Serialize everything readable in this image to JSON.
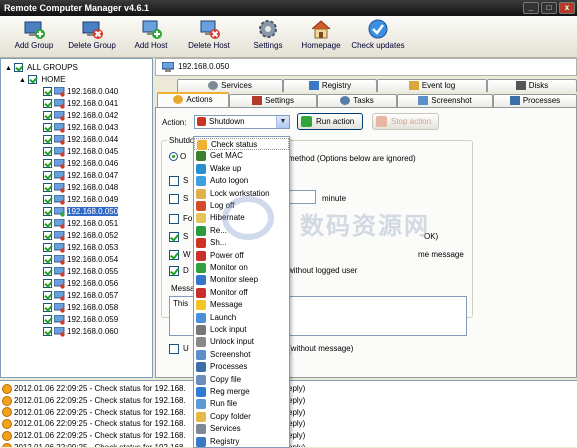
{
  "window": {
    "title": "Remote Computer Manager v4.6.1",
    "minimize": "_",
    "maximize": "□",
    "close": "x"
  },
  "toolbar": [
    {
      "label": "Add Group",
      "icon": "add-group-icon"
    },
    {
      "label": "Delete Group",
      "icon": "delete-group-icon"
    },
    {
      "label": "Add Host",
      "icon": "add-host-icon"
    },
    {
      "label": "Delete Host",
      "icon": "delete-host-icon"
    },
    {
      "label": "Settings",
      "icon": "gear-icon"
    },
    {
      "label": "Homepage",
      "icon": "home-icon"
    },
    {
      "label": "Check updates",
      "icon": "check-updates-icon"
    }
  ],
  "tree": {
    "root": "ALL GROUPS",
    "group": "HOME",
    "hosts": [
      "192.168.0.040",
      "192.168.0.041",
      "192.168.0.042",
      "192.168.0.043",
      "192.168.0.044",
      "192.168.0.045",
      "192.168.0.046",
      "192.168.0.047",
      "192.168.0.048",
      "192.168.0.049",
      "192.168.0.050",
      "192.168.0.051",
      "192.168.0.052",
      "192.168.0.053",
      "192.168.0.054",
      "192.168.0.055",
      "192.168.0.056",
      "192.168.0.057",
      "192.168.0.058",
      "192.168.0.059",
      "192.168.0.060"
    ]
  },
  "host_header": "192.168.0.050",
  "tabs_row1": [
    "Services",
    "Registry",
    "Event log",
    "Disks"
  ],
  "tabs_row2": [
    "Actions",
    "Settings",
    "Tasks",
    "Screenshot",
    "Processes"
  ],
  "actions": {
    "action_label": "Action:",
    "selected_action": "Shutdown",
    "run_button": "Run action",
    "stop_button": "Stop action",
    "shutdown_group": "Shutdo",
    "method_text": "method (Options below are ignored)",
    "minute_label": "minute",
    "ok_fragment": "OK)",
    "message_fragment": "me message",
    "without_user": "without logged user",
    "message_label": "Messa",
    "message_value": "This",
    "without_message": "(without message)",
    "option_labels": [
      "O",
      "S",
      "S",
      "Fo",
      "S",
      "W",
      "D",
      "U"
    ]
  },
  "dropdown_items": [
    {
      "label": "Check status",
      "color": "#f0b130"
    },
    {
      "label": "Get MAC",
      "color": "#3d7f2a"
    },
    {
      "label": "Wake up",
      "color": "#2a8fd1"
    },
    {
      "label": "Auto logon",
      "color": "#3aa0e0"
    },
    {
      "label": "Lock workstation",
      "color": "#e2b04a"
    },
    {
      "label": "Log off",
      "color": "#d24b2a"
    },
    {
      "label": "Hibernate",
      "color": "#e7c35b"
    },
    {
      "label": "Re...",
      "color": "#2b9a3a"
    },
    {
      "label": "Sh...",
      "color": "#cc3322"
    },
    {
      "label": "Power off",
      "color": "#c9302c"
    },
    {
      "label": "Monitor on",
      "color": "#32a041"
    },
    {
      "label": "Monitor sleep",
      "color": "#3377cc"
    },
    {
      "label": "Monitor off",
      "color": "#c9302c"
    },
    {
      "label": "Message",
      "color": "#f3c623"
    },
    {
      "label": "Launch",
      "color": "#4a90d9"
    },
    {
      "label": "Lock input",
      "color": "#777777"
    },
    {
      "label": "Unlock input",
      "color": "#888888"
    },
    {
      "label": "Screenshot",
      "color": "#5a8fc9"
    },
    {
      "label": "Processes",
      "color": "#3c6ea8"
    },
    {
      "label": "Copy file",
      "color": "#6a8fbf"
    },
    {
      "label": "Reg merge",
      "color": "#2f7bd1"
    },
    {
      "label": "Run file",
      "color": "#5b9bd5"
    },
    {
      "label": "Copy folder",
      "color": "#e6b84a"
    },
    {
      "label": "Services",
      "color": "#7d8a96"
    },
    {
      "label": "Registry",
      "color": "#3b78c4"
    }
  ],
  "log": [
    {
      "time": "2012.01.06 22:09:25",
      "text": "- Check status for 192.168.",
      "tail": "eply)"
    },
    {
      "time": "2012.01.06 22:09:25",
      "text": "- Check status for 192.168.",
      "tail": "eply)"
    },
    {
      "time": "2012.01.06 22:09:25",
      "text": "- Check status for 192.168.",
      "tail": "eply)"
    },
    {
      "time": "2012.01.06 22:09:25",
      "text": "- Check status for 192.168.",
      "tail": "eply)"
    },
    {
      "time": "2012.01.06 22:09:25",
      "text": "- Check status for 192.168.",
      "tail": "eply)"
    },
    {
      "time": "2012.01.06 22:09:25",
      "text": "- Check status for 192.168.",
      "tail": "eply)"
    }
  ],
  "watermark": "数码资源网"
}
